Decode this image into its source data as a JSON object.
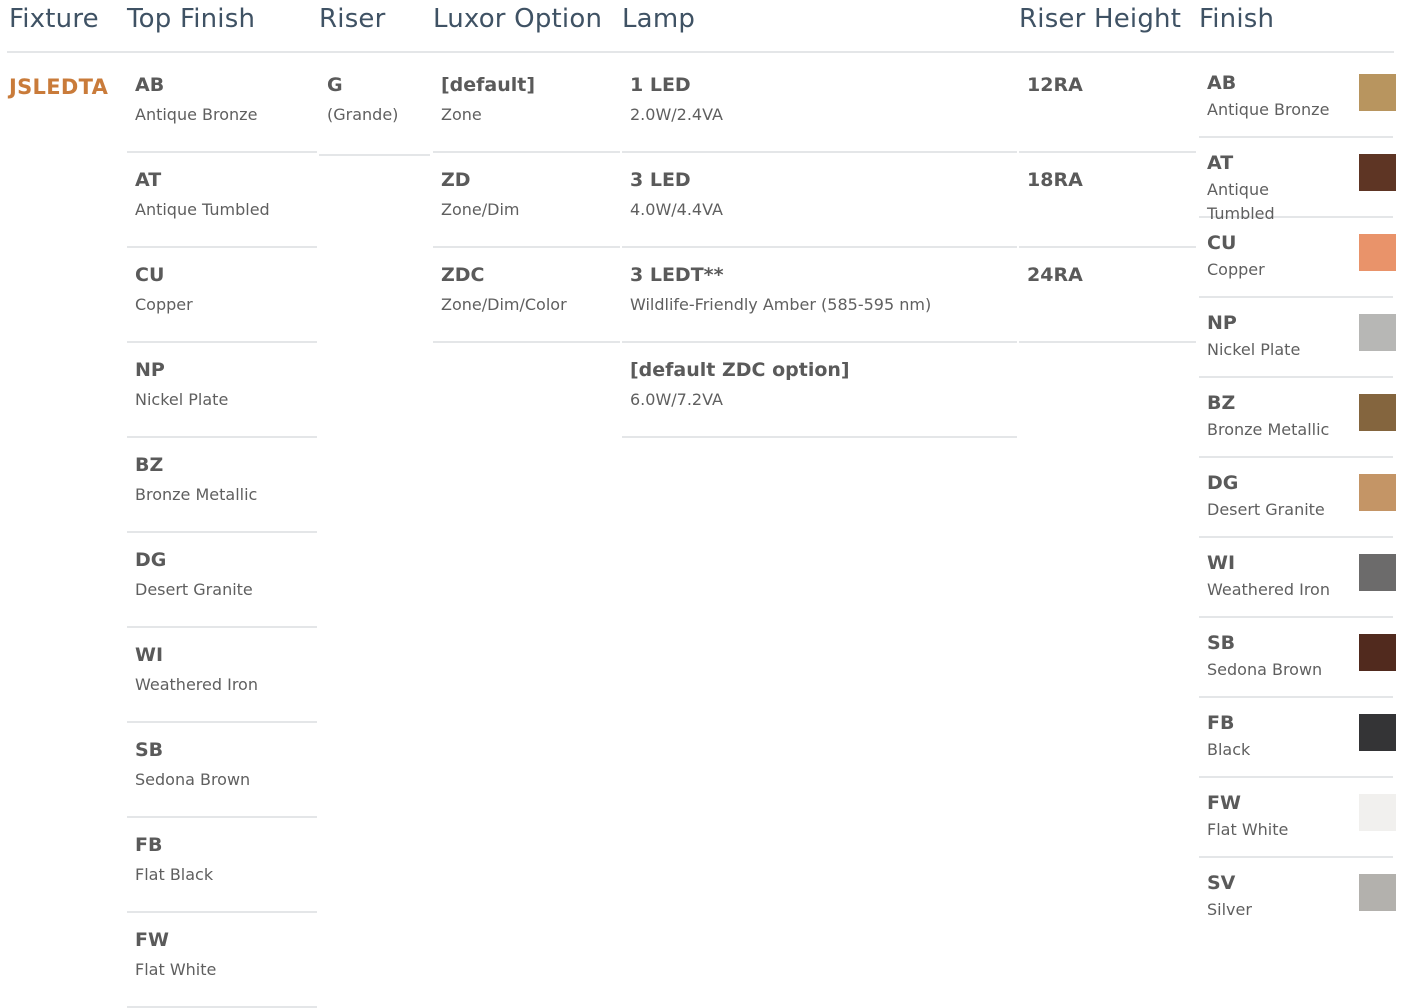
{
  "headers": {
    "fixture": "Fixture",
    "top_finish": "Top Finish",
    "riser": "Riser",
    "luxor_option": "Luxor Option",
    "lamp": "Lamp",
    "riser_height": "Riser Height",
    "finish": "Finish"
  },
  "fixture": "JSLEDTA",
  "top_finish": [
    {
      "code": "AB",
      "name": "Antique Bronze"
    },
    {
      "code": "AT",
      "name": "Antique Tumbled"
    },
    {
      "code": "CU",
      "name": "Copper"
    },
    {
      "code": "NP",
      "name": "Nickel Plate"
    },
    {
      "code": "BZ",
      "name": "Bronze Metallic"
    },
    {
      "code": "DG",
      "name": "Desert Granite"
    },
    {
      "code": "WI",
      "name": "Weathered Iron"
    },
    {
      "code": "SB",
      "name": "Sedona Brown"
    },
    {
      "code": "FB",
      "name": "Flat Black"
    },
    {
      "code": "FW",
      "name": "Flat White"
    }
  ],
  "riser": [
    {
      "code": "G",
      "name": "(Grande)"
    }
  ],
  "luxor_option": [
    {
      "code": "[default]",
      "name": "Zone"
    },
    {
      "code": "ZD",
      "name": "Zone/Dim"
    },
    {
      "code": "ZDC",
      "name": "Zone/Dim/Color"
    }
  ],
  "lamp": [
    {
      "code": "1 LED",
      "name": "2.0W/2.4VA"
    },
    {
      "code": "3 LED",
      "name": "4.0W/4.4VA"
    },
    {
      "code": "3 LEDT**",
      "name": "Wildlife-Friendly Amber (585-595 nm)"
    },
    {
      "code": "[default ZDC option]",
      "name": "6.0W/7.2VA"
    }
  ],
  "riser_height": [
    {
      "code": "12RA"
    },
    {
      "code": "18RA"
    },
    {
      "code": "24RA"
    }
  ],
  "finish": [
    {
      "code": "AB",
      "name": "Antique Bronze",
      "swatch": "#b8955f"
    },
    {
      "code": "AT",
      "name": "Antique Tumbled",
      "swatch": "#5e3524"
    },
    {
      "code": "CU",
      "name": "Copper",
      "swatch": "#e9936a"
    },
    {
      "code": "NP",
      "name": "Nickel Plate",
      "swatch": "#b7b7b5"
    },
    {
      "code": "BZ",
      "name": "Bronze Metallic",
      "swatch": "#84653e"
    },
    {
      "code": "DG",
      "name": "Desert Granite",
      "swatch": "#c49566"
    },
    {
      "code": "WI",
      "name": "Weathered Iron",
      "swatch": "#6c6b6b"
    },
    {
      "code": "SB",
      "name": "Sedona Brown",
      "swatch": "#512a1e"
    },
    {
      "code": "FB",
      "name": "Black",
      "swatch": "#343436"
    },
    {
      "code": "FW",
      "name": "Flat White",
      "swatch": "#f1f0ee"
    },
    {
      "code": "SV",
      "name": "Silver",
      "swatch": "#b3b1ad"
    }
  ]
}
